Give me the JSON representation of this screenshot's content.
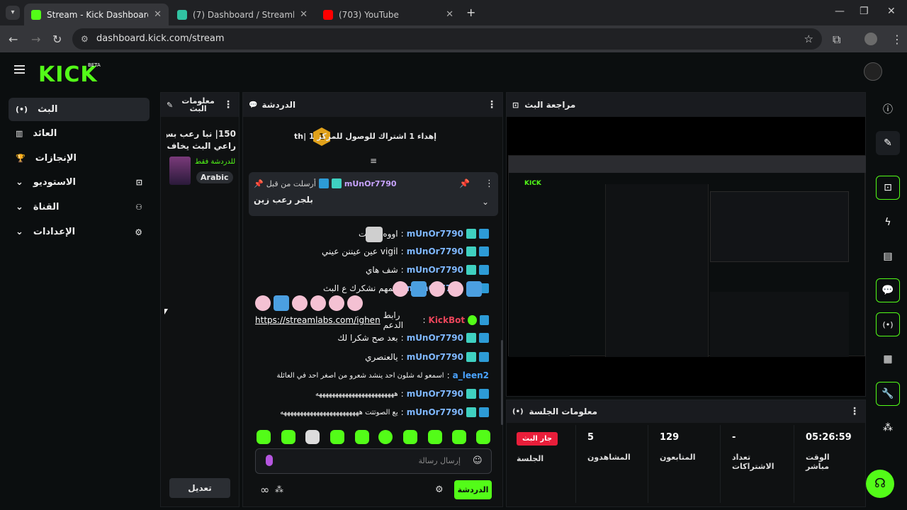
{
  "browser": {
    "tabs": [
      {
        "title": "Stream - Kick Dashboard",
        "favicon_color": "#53fc18"
      },
      {
        "title": "(7) Dashboard / Streamlabs",
        "favicon_color": "#31c3a2"
      },
      {
        "title": "(703) YouTube",
        "favicon_color": "#ff0000"
      }
    ],
    "url": "dashboard.kick.com/stream"
  },
  "app": {
    "logo": "KICK",
    "beta": "BETA",
    "accent": "#53fc18"
  },
  "sidebar": {
    "items": [
      {
        "label": "البث",
        "icon": "broadcast-icon"
      },
      {
        "label": "العائد",
        "icon": "chart-icon"
      },
      {
        "label": "الإنجازات",
        "icon": "trophy-icon"
      },
      {
        "label": "الاستوديو",
        "icon": "camera-icon"
      },
      {
        "label": "القناة",
        "icon": "users-icon"
      },
      {
        "label": "الإعدادات",
        "icon": "gear-icon"
      }
    ]
  },
  "stream_info": {
    "title": "معلومات البث",
    "stream_title_line1": "150| نبا رعب بس",
    "stream_title_line2": "راعي البث يخاف...",
    "category": "للدردشة فقط",
    "language": "Arabic",
    "edit_label": "تعديل"
  },
  "chat": {
    "title": "الدردشة",
    "goal_text": "إهداء 1 اشتراك للوصول للمركز 1 |th",
    "goal_rank": "1",
    "pinned_by_prefix": "أرسلت من قبل",
    "pinned_user": "mUnOr7790",
    "pinned_message": "بلجر رعب زين",
    "messages": [
      {
        "user": "mUnOr7790",
        "text": "اووه كيوتت"
      },
      {
        "user": "mUnOr7790",
        "text": "عين عيننن عيني vigil"
      },
      {
        "user": "mUnOr7790",
        "text": "شف هاي"
      },
      {
        "user": "mUnOr7790",
        "text": "المهم نشكرك ع البث"
      },
      {
        "user": "KickBot",
        "text": "رابط الدعم",
        "link": "https://streamlabs.com/ighen"
      },
      {
        "user": "mUnOr7790",
        "text": "بعد صح شكرا لك"
      },
      {
        "user": "mUnOr7790",
        "text": "يالعنصري"
      },
      {
        "user": "a_leen2",
        "text": "اسمعو له شلون احد ينشد شعرو من اصغر احد في العائلة"
      },
      {
        "user": "mUnOr7790",
        "text": "ههههههههههههههههههههههههه"
      },
      {
        "user": "mUnOr7790",
        "text": "يع الصوتتت ههههههههههههههههههههههههه"
      }
    ],
    "input_placeholder": "إرسال رسالة",
    "send_label": "الدردشة"
  },
  "preview": {
    "title": "مراجعة البث"
  },
  "session": {
    "title": "معلومات الجلسة",
    "live_badge": "جار البث",
    "session_label": "الجلسة",
    "stats": [
      {
        "value": "05:26:59",
        "label": "الوقت مباشر"
      },
      {
        "value": "-",
        "label": "تعداد الاشتراكات"
      },
      {
        "value": "129",
        "label": "المتابعون"
      },
      {
        "value": "5",
        "label": "المشاهدون"
      }
    ]
  }
}
